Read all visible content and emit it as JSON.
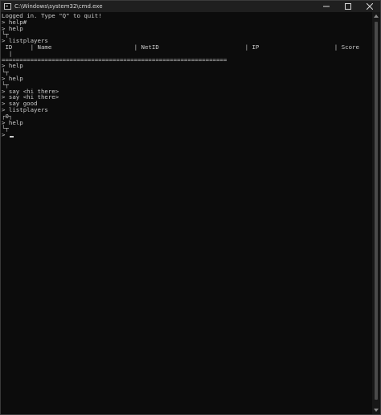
{
  "window": {
    "title": "C:\\Windows\\system32\\cmd.exe"
  },
  "console": {
    "lines": [
      "Logged in. Type \"Q\" to quit!",
      "> help#",
      "> help",
      "└┬",
      "> listplayers",
      " ID     | Name                       | NetID                        | IP                     | Score",
      "  |",
      "===============================================================",
      "> help",
      "└┬",
      "> help",
      "└┬",
      "> say <hi there>",
      "> say <hi there>",
      "> say good",
      "> listplayers",
      "┌0┐",
      "> help",
      "└┬"
    ],
    "prompt": ">"
  },
  "colors": {
    "background": "#0c0c0c",
    "text": "#cccccc",
    "titlebar": "#1f1f1f"
  },
  "icons": {
    "app": "cmd-app-icon",
    "minimize": "minimize-icon",
    "maximize": "maximize-icon",
    "close": "close-icon"
  }
}
